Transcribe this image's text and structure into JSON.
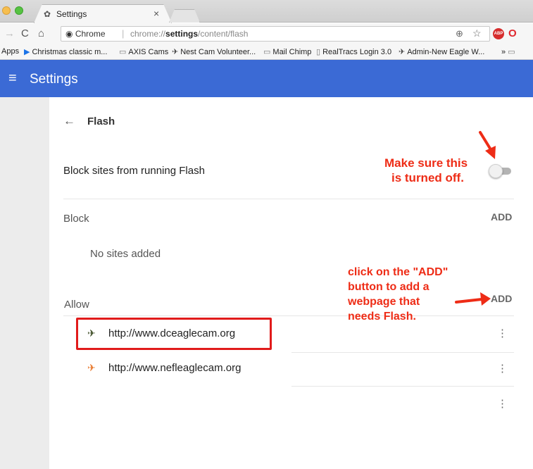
{
  "browser": {
    "tab": {
      "title": "Settings",
      "icon": "gear-icon",
      "close": "×"
    },
    "omnibox": {
      "chip": "Chrome",
      "separator": "|",
      "url_prefix": "chrome://",
      "url_bold": "settings",
      "url_suffix": "/content/flash"
    },
    "extensions": {
      "abp": "ABP",
      "opera": "O"
    },
    "bookmarks": [
      {
        "label": "Apps",
        "icon": ""
      },
      {
        "label": "Christmas classic m...",
        "icon": "bookmark-blue-icon"
      },
      {
        "label": "AXIS Cams",
        "icon": "folder-icon"
      },
      {
        "label": "Nest Cam Volunteer...",
        "icon": "eagle-icon"
      },
      {
        "label": "Mail Chimp",
        "icon": "folder-icon"
      },
      {
        "label": "RealTracs Login 3.0",
        "icon": "page-icon"
      },
      {
        "label": "Admin-New Eagle W...",
        "icon": "eagle-icon"
      },
      {
        "label": "»",
        "icon": ""
      }
    ]
  },
  "header": {
    "title": "Settings"
  },
  "page": {
    "title": "Flash",
    "toggle_row": {
      "label": "Block sites from running Flash",
      "on": false
    },
    "block": {
      "label": "Block",
      "add": "ADD",
      "empty": "No sites added"
    },
    "allow": {
      "label": "Allow",
      "add": "ADD",
      "sites": [
        {
          "url": "http://www.dceaglecam.org",
          "icon": "eagle-dark-icon"
        },
        {
          "url": "http://www.nefleaglecam.org",
          "icon": "eagle-orange-icon"
        }
      ]
    }
  },
  "annotations": {
    "toggle_note": [
      "Make sure this",
      "is turned off."
    ],
    "add_note": [
      "click on the \"ADD\"",
      "button to add a",
      "webpage that",
      "needs Flash."
    ]
  },
  "colors": {
    "header_blue": "#3b6ad5",
    "annotation_red": "#ee2c16",
    "highlight_red": "#e11b1b"
  }
}
